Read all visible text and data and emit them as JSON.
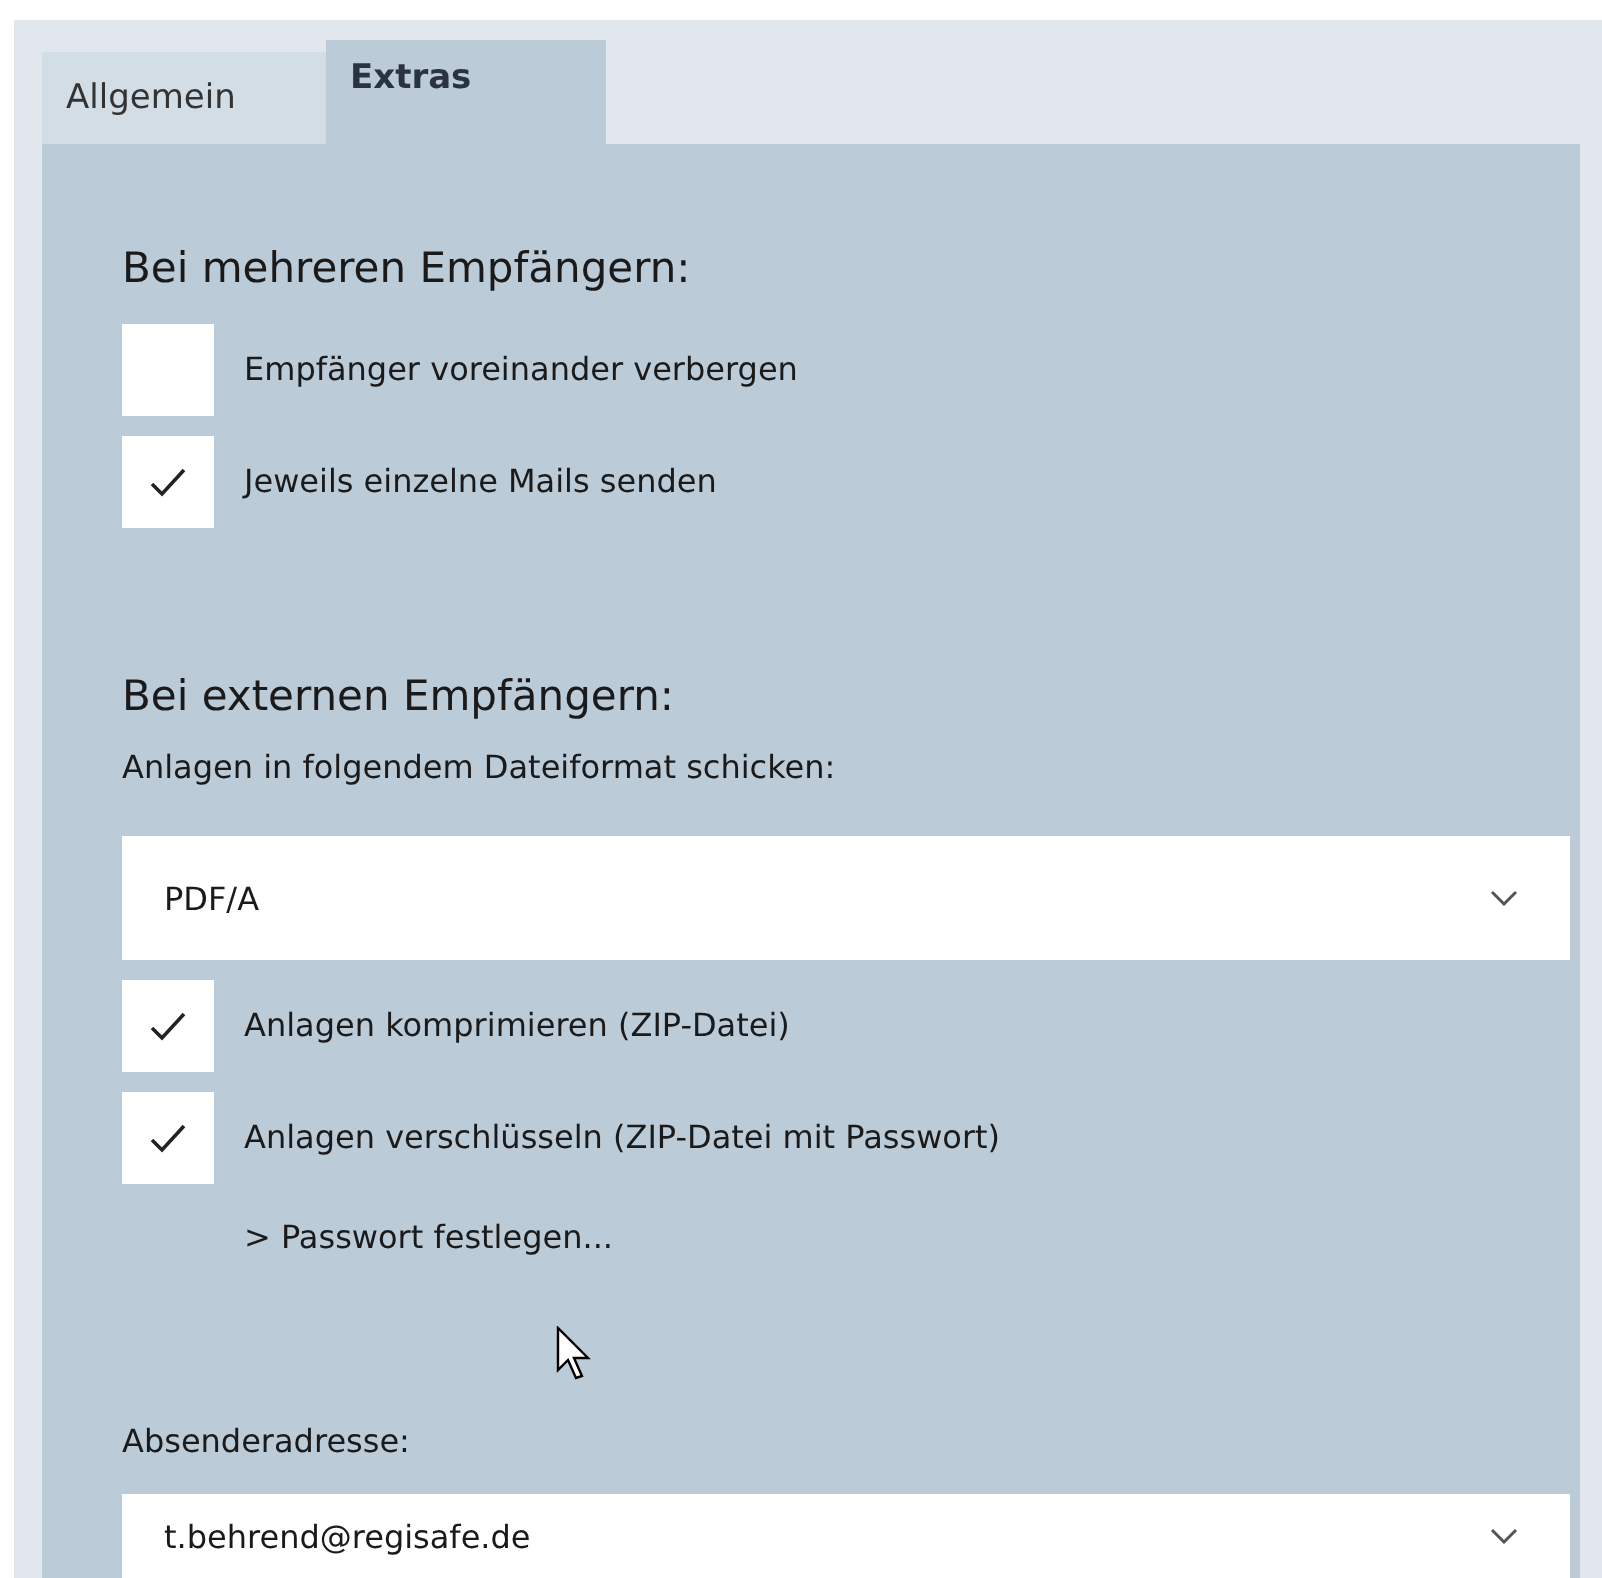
{
  "tabs": [
    {
      "label": "Allgemein",
      "selected": false
    },
    {
      "label": "Extras",
      "selected": true
    }
  ],
  "sections": [
    {
      "heading": "Bei mehreren Empfängern:",
      "items": [
        {
          "kind": "checkbox",
          "label": "Empfänger voreinander verbergen",
          "checked": false
        },
        {
          "kind": "checkbox",
          "label": "Jeweils einzelne Mails senden",
          "checked": true
        }
      ]
    },
    {
      "heading": "Bei externen Empfängern:",
      "items": [
        {
          "kind": "label",
          "label": "Anlagen in folgendem Dateiformat schicken:"
        },
        {
          "kind": "dropdown",
          "value": "PDF/A"
        },
        {
          "kind": "checkbox",
          "label": "Anlagen komprimieren (ZIP-Datei)",
          "checked": true
        },
        {
          "kind": "checkbox",
          "label": "Anlagen verschlüsseln (ZIP-Datei mit Passwort)",
          "checked": true
        },
        {
          "kind": "link",
          "label": "> Passwort festlegen..."
        }
      ]
    },
    {
      "items": [
        {
          "kind": "label",
          "label": "Absenderadresse:"
        },
        {
          "kind": "dropdown",
          "value": "t.behrend@regisafe.de"
        }
      ]
    }
  ]
}
